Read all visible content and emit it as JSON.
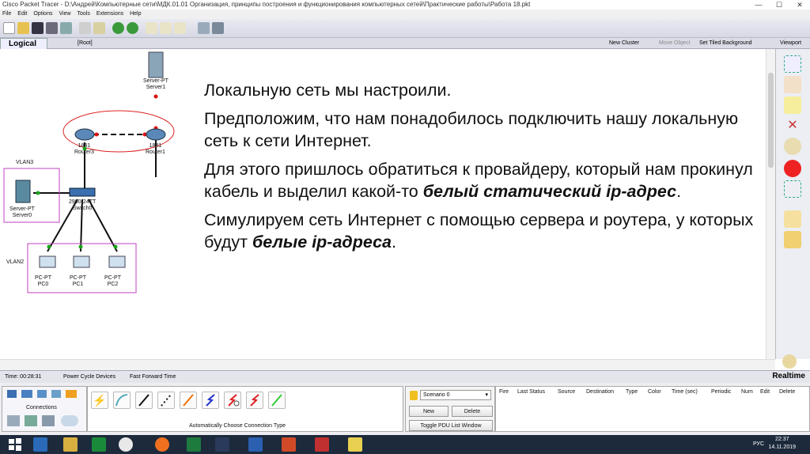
{
  "window": {
    "title": "Cisco Packet Tracer - D:\\Андрей\\Компьютерные сети\\МДК.01.01 Организация, принципы построения и функционирования компьютерных сетей\\Практические работы\\Работа 18.pkt",
    "controls": [
      "—",
      "☐",
      "✕"
    ]
  },
  "menu": [
    "File",
    "Edit",
    "Options",
    "View",
    "Tools",
    "Extensions",
    "Help"
  ],
  "workspace_bar": {
    "logical_tab": "Logical",
    "root_label": "[Root]",
    "new_cluster": "New Cluster",
    "move_object": "Move Object",
    "set_tiled_background": "Set Tiled Background",
    "viewport": "Viewport"
  },
  "topology": {
    "vlan3_label": "VLAN3",
    "vlan2_label": "VLAN2",
    "devices": [
      {
        "type": "Server-PT",
        "name": "Server1"
      },
      {
        "type": "1841",
        "name": "Router3"
      },
      {
        "type": "1841",
        "name": "Router1"
      },
      {
        "type": "Server-PT",
        "name": "Server0"
      },
      {
        "type": "2960-24TT",
        "name": "Switch0"
      },
      {
        "type": "PC-PT",
        "name": "PC0"
      },
      {
        "type": "PC-PT",
        "name": "PC1"
      },
      {
        "type": "PC-PT",
        "name": "PC2"
      }
    ]
  },
  "slide": {
    "p1": "Локальную сеть мы настроили.",
    "p2": "Предположим, что нам понадобилось подключить нашу локальную сеть к сети Интернет.",
    "p3_pre": "Для этого пришлось обратиться к провайдеру, который нам прокинул кабель и выделил какой-то ",
    "p3_emph": "белый  статический  ip-адрес",
    "p3_post": ".",
    "p4_pre": "Симулируем сеть Интернет с помощью сервера и роутера, у которых будут ",
    "p4_emph": "белые  ip-адреса",
    "p4_post": "."
  },
  "status": {
    "time": "Time: 00:28:31",
    "power_cycle": "Power Cycle Devices",
    "fast_forward": "Fast Forward Time",
    "mode": "Realtime"
  },
  "bottom": {
    "category_label": "Connections",
    "connection_hint": "Automatically Choose Connection Type",
    "scenario": "Scenario 0",
    "new_button": "New",
    "delete_button": "Delete",
    "toggle_pdu": "Toggle PDU List Window",
    "pdu_columns": [
      "Fire",
      "Last Status",
      "Source",
      "Destination",
      "Type",
      "Color",
      "Time (sec)",
      "Periodic",
      "Num",
      "Edit",
      "Delete"
    ]
  },
  "taskbar": {
    "lang": "РУС",
    "time": "22:37",
    "date": "14.11.2019"
  },
  "colors": {
    "switch_blue": "#3a6fb0",
    "link_green": "#1aa31a",
    "link_red": "#d11",
    "vlan_border": "#c040c0",
    "taskbar": "#1c2a3c"
  }
}
